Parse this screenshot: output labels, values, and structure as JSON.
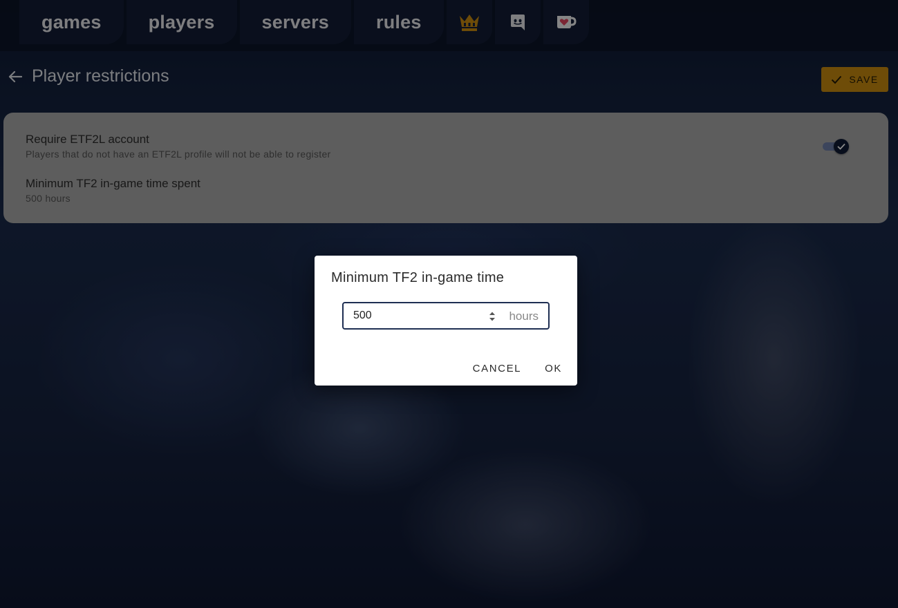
{
  "nav": {
    "items": [
      {
        "label": "games"
      },
      {
        "label": "players"
      },
      {
        "label": "servers"
      },
      {
        "label": "rules"
      }
    ],
    "icons": [
      "crown-icon",
      "discord-icon",
      "ko-fi-icon"
    ]
  },
  "header": {
    "title": "Player restrictions",
    "save_label": "SAVE"
  },
  "settings": {
    "etf2l": {
      "title": "Require ETF2L account",
      "subtitle": "Players that do not have an ETF2L profile will not be able to register",
      "enabled": true
    },
    "min_time": {
      "title": "Minimum TF2 in-game time spent",
      "subtitle": "500 hours"
    }
  },
  "dialog": {
    "title": "Minimum TF2 in-game time",
    "input_value": "500",
    "suffix": "hours",
    "cancel_label": "CANCEL",
    "ok_label": "OK"
  },
  "colors": {
    "accent": "#c98a10",
    "toggle_track": "#6e7fa8",
    "toggle_thumb": "#0f1a33",
    "field_border": "#1e2e52"
  }
}
